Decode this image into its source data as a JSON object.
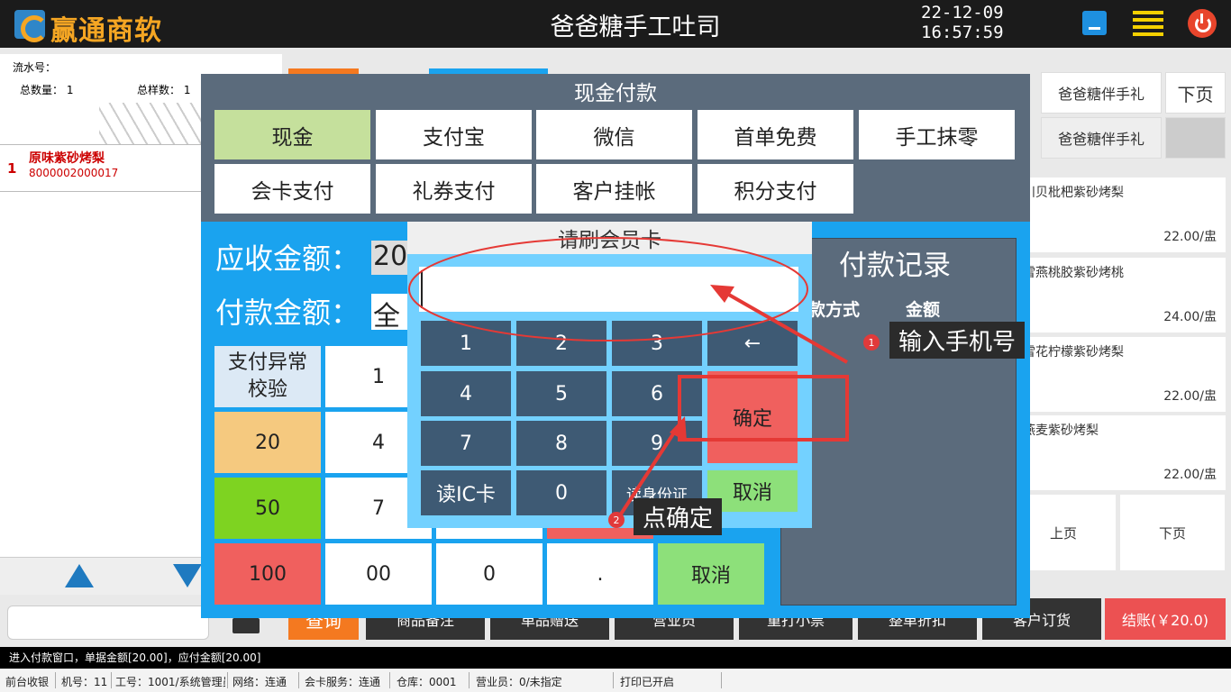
{
  "header": {
    "logo_text": "赢通商软",
    "shop_title": "爸爸糖手工吐司",
    "date": "22-12-09",
    "time": "16:57:59"
  },
  "order": {
    "serial_label": "流水号：",
    "total_qty": "总数量：  1",
    "total_kinds": "总样数：  1",
    "items": [
      {
        "index": "1",
        "name": "原味紫砂烤梨",
        "code": "8000002000017"
      }
    ]
  },
  "right_tabs": {
    "cat1": "爸爸糖伴手礼",
    "cat2": "爸爸糖伴手礼",
    "next_page": "下页"
  },
  "products": [
    {
      "name": "川贝枇杷紫砂烤梨",
      "price": "22.00/盅"
    },
    {
      "name": "雪燕桃胶紫砂烤桃",
      "price": "24.00/盅"
    },
    {
      "name": "雪花柠檬紫砂烤梨",
      "price": "22.00/盅"
    },
    {
      "name": "燕麦紫砂烤梨",
      "price": "22.00/盅"
    }
  ],
  "product_pager": {
    "prev": "上页",
    "next": "下页"
  },
  "bottom_bar": {
    "query": "查询",
    "b1": "商品备注",
    "b2": "单品赠送",
    "b3": "营业员",
    "b4": "重打小票",
    "b5": "整单折扣",
    "b6": "客户订货",
    "checkout": "结账(￥20.0)"
  },
  "payment": {
    "title": "现金付款",
    "methods": [
      "现金",
      "支付宝",
      "微信",
      "首单免费",
      "手工抹零",
      "会卡支付",
      "礼券支付",
      "客户挂帐",
      "积分支付"
    ],
    "due_label": "应收金额",
    "due_value": "20",
    "paid_label": "付款金额",
    "paid_value": "全",
    "keys": {
      "abnormal": "支付异常校验",
      "q20": "20",
      "q50": "50",
      "q100": "100",
      "k1": "1",
      "k4": "4",
      "k7": "7",
      "k00": "00",
      "k0": "0",
      "kdot": ".",
      "cancel": "取消"
    },
    "records_title": "付款记录",
    "records_col_method": "款方式",
    "records_col_amount": "金额"
  },
  "card_dialog": {
    "title": "请刷会员卡",
    "input_value": "",
    "keys": [
      "1",
      "2",
      "3",
      "←",
      "4",
      "5",
      "6",
      "7",
      "8",
      "9"
    ],
    "read_ic": "读IC卡",
    "zero": "0",
    "read_id": "读身份证",
    "ok": "确定",
    "cancel": "取消"
  },
  "annotations": {
    "step1_num": "1",
    "step1_text": "输入手机号",
    "step2_num": "2",
    "step2_text": "点确定",
    "color": "#e53935"
  },
  "status": {
    "message": "进入付款窗口，单据金额[20.00]，应付金额[20.00]",
    "mode": "前台收银",
    "machine": "机号：11",
    "worker": "工号：1001/系统管理员",
    "network": "网络：连通",
    "card_service": "会卡服务：连通",
    "warehouse": "仓库：0001",
    "salesman": "营业员：0/未指定",
    "printer": "打印已开启"
  }
}
